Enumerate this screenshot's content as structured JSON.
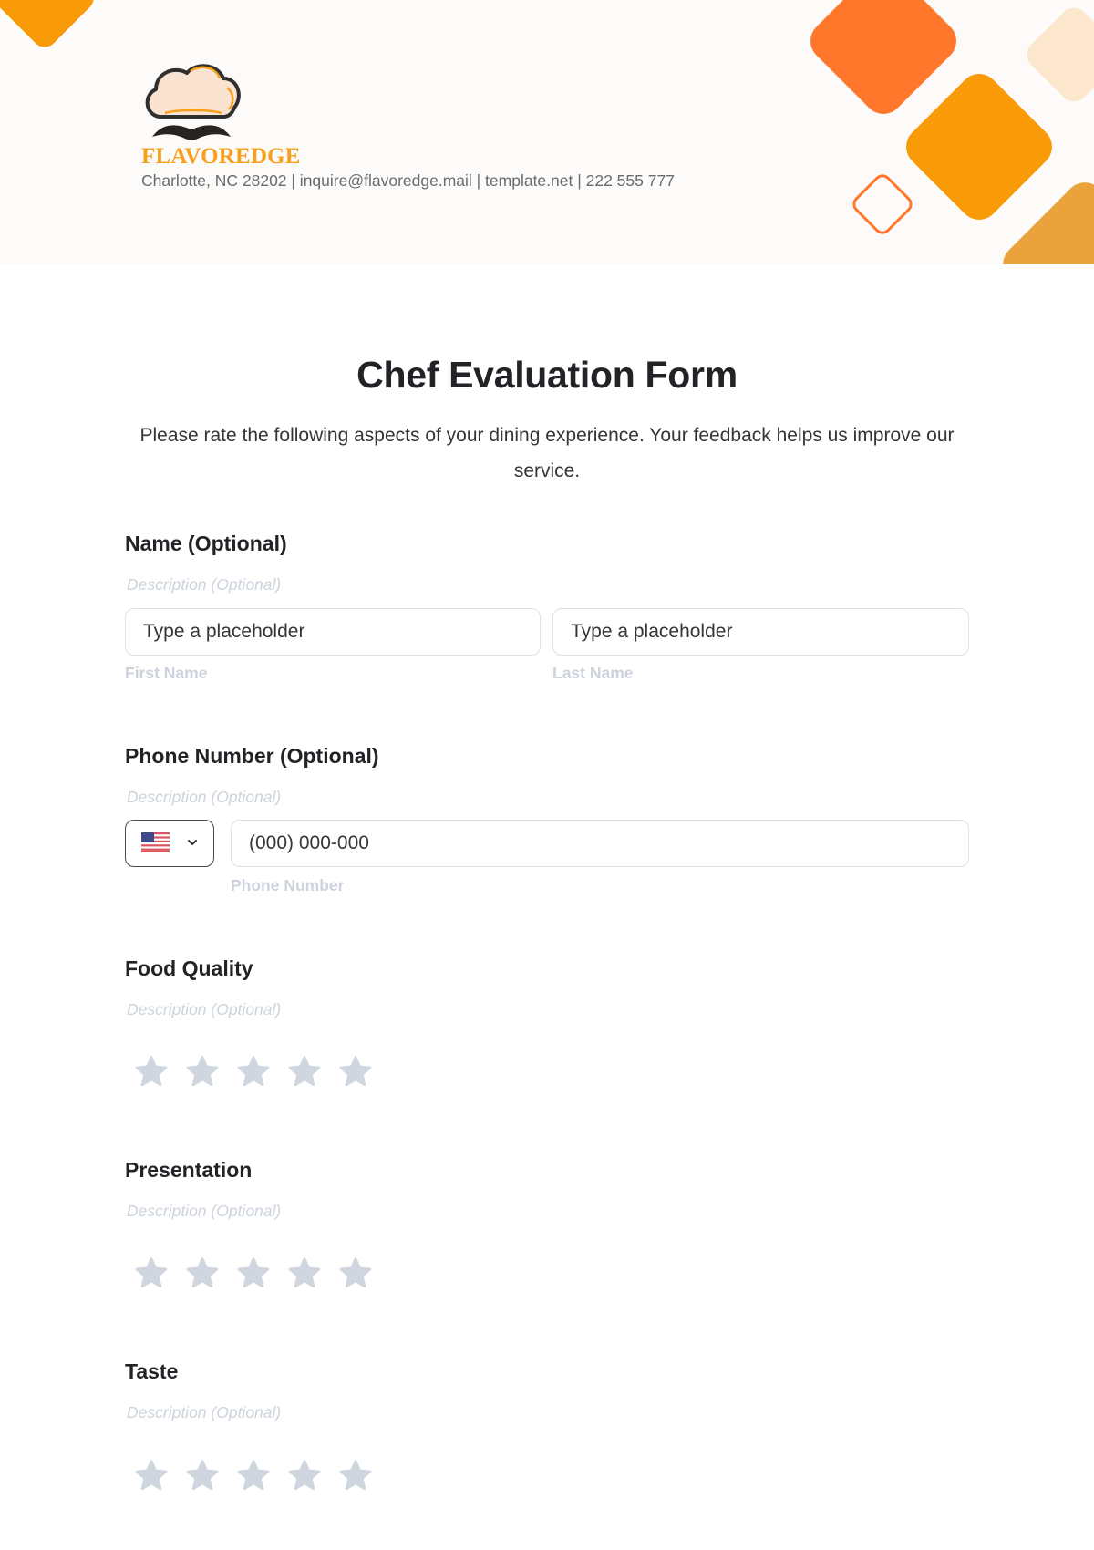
{
  "header": {
    "brand_name": "FLAVOREDGE",
    "contact_line": "Charlotte, NC 28202 | inquire@flavoredge.mail | template.net | 222 555 777",
    "logo_icon": "chef-hat-mustache-logo",
    "colors": {
      "band": "#fdfbf9",
      "orange_red": "#fe772b",
      "orange": "#f99a09",
      "peach": "#fde8cf",
      "amber": "#eaa33c",
      "brand_text": "#f7a01d"
    }
  },
  "form": {
    "title": "Chef Evaluation Form",
    "description": "Please rate the following aspects of your dining experience. Your feedback helps us improve our service.",
    "name_field": {
      "label": "Name (Optional)",
      "description": "Description (Optional)",
      "first_name": {
        "placeholder": "Type a placeholder",
        "value": "",
        "sublabel": "First Name"
      },
      "last_name": {
        "placeholder": "Type a placeholder",
        "value": "",
        "sublabel": "Last Name"
      }
    },
    "phone_field": {
      "label": "Phone Number (Optional)",
      "description": "Description (Optional)",
      "country": {
        "flag_icon": "us-flag-icon",
        "selected": "US"
      },
      "phone": {
        "placeholder": "(000) 000-000",
        "value": "",
        "sublabel": "Phone Number"
      }
    },
    "ratings": [
      {
        "label": "Food Quality",
        "description": "Description (Optional)",
        "max_stars": 5,
        "value": 0
      },
      {
        "label": "Presentation",
        "description": "Description (Optional)",
        "max_stars": 5,
        "value": 0
      },
      {
        "label": "Taste",
        "description": "Description (Optional)",
        "max_stars": 5,
        "value": 0
      }
    ],
    "star_color_empty": "#cfd6df"
  }
}
